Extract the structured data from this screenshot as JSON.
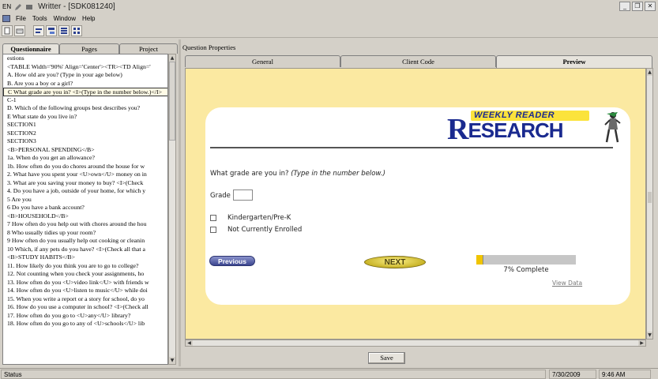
{
  "window": {
    "title": "Writter - [SDK081240]",
    "sys_label": "EN"
  },
  "menu": [
    "File",
    "Tools",
    "Window",
    "Help"
  ],
  "left_tabs": [
    "Questionnaire",
    "Pages",
    "Project"
  ],
  "tree_items": [
    "estions",
    "<TABLE Width='90%' Align='Center'><TR><TD Align='",
    "A. How old are you? (Type in your age below)",
    "B. Are you a boy or a girl?",
    "C What grade are you in? <I>(Type in the number below.)</I>",
    "C-1",
    "D. Which of the following groups best describes you?",
    "E What state do you live in?",
    "SECTION1",
    "SECTION2",
    "SECTION3",
    "<B>PERSONAL SPENDING</B>",
    "1a. When do you get an allowance?",
    "1b. How often do you do chores around the house for w",
    "2. What have you spent your <U>own</U> money on in",
    "3. What are you saving your money to buy?  <I>(Check",
    "4. Do you have a job, outside of your home, for which y",
    "5 Are you",
    "6 Do you have a bank account?",
    "<B>HOUSEHOLD</B>",
    "7 How often do you help out with chores around the hou",
    "8 Who usually tidies up your room?",
    "9 How often do you usually help out cooking or cleanin",
    "10 Which, if any pets do you have?  <I>(Check all  that a",
    "<B>STUDY HABITS</B>",
    "11. How likely do you think you are to go to college?",
    "12. Not counting when you check your assignments, ho",
    "13. How often do you <U>video link</U> with friends w",
    "14. How often do you <U>listen to music</U> while doi",
    "15. When you write a report or a story for school, do yo",
    "16. How do you use a computer in school? <I>(Check all",
    "17. How often do you go to <U>any</U> library?",
    "18. How often do you go to any of <U>schools</U> lib"
  ],
  "selected_index": 4,
  "properties_label": "Question Properties",
  "right_tabs": [
    "General",
    "Client Code",
    "Preview"
  ],
  "logo": {
    "top": "WEEKLY READER",
    "letter": "R",
    "rest": "ESEARCH"
  },
  "question": {
    "text": "What grade are you in?",
    "hint": "(Type in the number below.)",
    "grade_label": "Grade",
    "options": [
      "Kindergarten/Pre-K",
      "Not Currently Enrolled"
    ]
  },
  "nav": {
    "previous": "Previous",
    "next": "NEXT",
    "progress_fraction": 0.07,
    "progress_text": "7% Complete",
    "view_data": "View Data"
  },
  "save_label": "Save",
  "status": {
    "label": "Status",
    "date": "7/30/2009",
    "time": "9:46 AM"
  },
  "colors": {
    "preview_bg": "#fbe9a1",
    "logo_blue": "#1a2a8f",
    "logo_yellow": "#fbe33c",
    "progress_fill": "#f0c400"
  }
}
